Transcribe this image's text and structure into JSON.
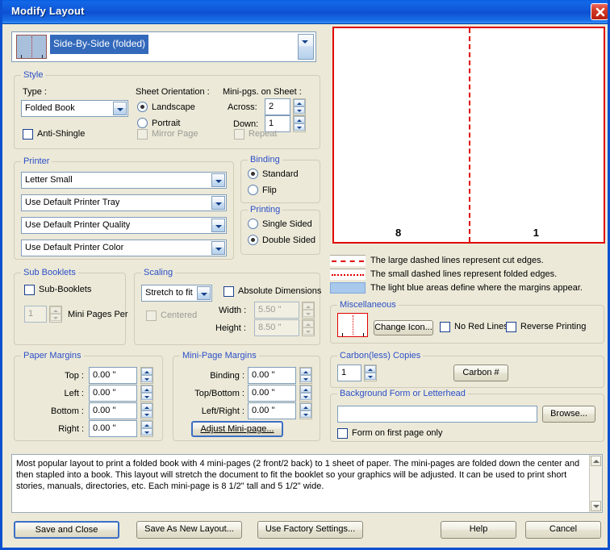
{
  "window": {
    "title": "Modify Layout",
    "close_icon": "close-icon",
    "accent": "#0a50d0",
    "face": "#ece9d8"
  },
  "layout_selector": {
    "value": "Side-By-Side (folded)",
    "thumbnail_icon": "side-by-side-folded-thumbnail"
  },
  "style": {
    "title": "Style",
    "type_label": "Type :",
    "type_value": "Folded Book",
    "anti_shingle_label": "Anti-Shingle",
    "anti_shingle_checked": false,
    "sheet_orientation_label": "Sheet Orientation :",
    "orientation_options": [
      "Landscape",
      "Portrait"
    ],
    "orientation_selected": "Landscape",
    "mirror_page_label": "Mirror Page",
    "mirror_page_checked": false,
    "mirror_page_enabled": false,
    "minipgs_label": "Mini-pgs. on Sheet :",
    "across_label": "Across:",
    "across_value": "2",
    "down_label": "Down:",
    "down_value": "1",
    "repeat_label": "Repeat",
    "repeat_checked": false,
    "repeat_enabled": false
  },
  "printer": {
    "title": "Printer",
    "paper": "Letter Small",
    "tray": "Use Default Printer Tray",
    "quality": "Use Default Printer Quality",
    "color": "Use Default Printer Color"
  },
  "binding": {
    "title": "Binding",
    "options": [
      "Standard",
      "Flip"
    ],
    "selected": "Standard"
  },
  "printing": {
    "title": "Printing",
    "options": [
      "Single Sided",
      "Double Sided"
    ],
    "selected": "Double Sided"
  },
  "sub_booklets": {
    "title": "Sub Booklets",
    "checkbox_label": "Sub-Booklets",
    "checked": false,
    "count_value": "1",
    "count_enabled": false,
    "mini_pages_per_label": "Mini Pages Per"
  },
  "scaling": {
    "title": "Scaling",
    "mode_value": "Stretch to fit",
    "centered_label": "Centered",
    "centered_checked": false,
    "centered_enabled": false,
    "absolute_label": "Absolute Dimensions",
    "absolute_checked": false,
    "width_label": "Width :",
    "width_value": "5.50 \"",
    "height_label": "Height :",
    "height_value": "8.50 \"",
    "dimensions_enabled": false
  },
  "paper_margins": {
    "title": "Paper Margins",
    "rows": [
      {
        "label": "Top :",
        "value": "0.00 \""
      },
      {
        "label": "Left :",
        "value": "0.00 \""
      },
      {
        "label": "Bottom :",
        "value": "0.00 \""
      },
      {
        "label": "Right :",
        "value": "0.00 \""
      }
    ]
  },
  "mini_page_margins": {
    "title": "Mini-Page Margins",
    "rows": [
      {
        "label": "Binding :",
        "value": "0.00 \""
      },
      {
        "label": "Top/Bottom :",
        "value": "0.00 \""
      },
      {
        "label": "Left/Right :",
        "value": "0.00 \""
      }
    ],
    "adjust_button": "Adjust Mini-page..."
  },
  "preview": {
    "left_page_number": "8",
    "right_page_number": "1",
    "cut_edge_color": "#e00000"
  },
  "legend": [
    {
      "swatch": "large-dashed-line-swatch",
      "text": "The large dashed lines represent cut edges."
    },
    {
      "swatch": "small-dashed-line-swatch",
      "text": "The small dashed lines represent folded edges."
    },
    {
      "swatch": "light-blue-area-swatch",
      "text": "The light blue areas define where the margins appear."
    }
  ],
  "miscellaneous": {
    "title": "Miscellaneous",
    "icon_preview": "layout-icon-preview",
    "change_icon_button": "Change Icon...",
    "no_red_lines_label": "No Red Lines",
    "no_red_lines_checked": false,
    "reverse_printing_label": "Reverse Printing",
    "reverse_printing_checked": false
  },
  "carbon_copies": {
    "title": "Carbon(less) Copies",
    "count_value": "1",
    "carbon_button": "Carbon #"
  },
  "background_form": {
    "title": "Background Form or Letterhead",
    "path_value": "",
    "path_placeholder": "",
    "browse_button": "Browse...",
    "first_page_only_label": "Form on first page only",
    "first_page_only_checked": false
  },
  "description": {
    "text": "Most popular layout to print a folded book with 4 mini-pages (2 front/2 back) to 1 sheet of paper. The mini-pages are folded down the center and then stapled into a book.  This layout will stretch the document to fit the booklet so your graphics will be adjusted.  It can be used to print short stories, manuals, directories, etc.  Each mini-page is 8 1/2\" tall and 5 1/2\" wide."
  },
  "footer_buttons": {
    "save_and_close": "Save and Close",
    "save_as_new_layout": "Save As New Layout...",
    "use_factory_settings": "Use Factory Settings...",
    "help": "Help",
    "cancel": "Cancel"
  }
}
